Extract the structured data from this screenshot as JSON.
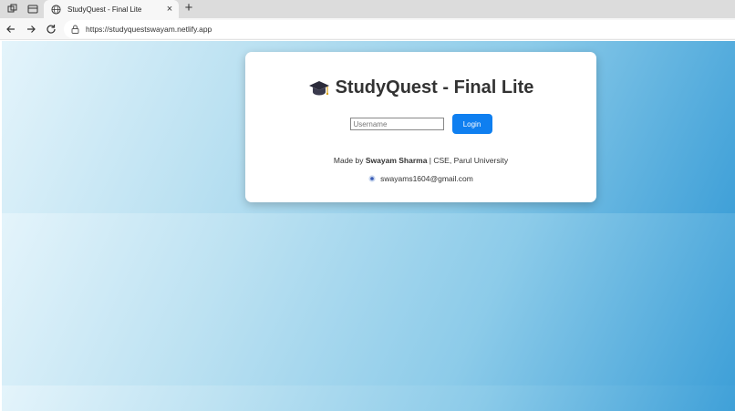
{
  "browser": {
    "tab_title": "StudyQuest - Final Lite",
    "tab_close": "×",
    "new_tab": "+",
    "url": "https://studyquestswayam.netlify.app"
  },
  "page": {
    "title": "StudyQuest - Final Lite",
    "username_placeholder": "Username",
    "login_label": "Login",
    "credit_prefix": "Made by ",
    "credit_name": "Swayam Sharma",
    "credit_suffix": " | CSE, Parul University",
    "email": "swayams1604@gmail.com"
  },
  "colors": {
    "login_button": "#0f7ff0",
    "gradient_start": "#e4f4fb",
    "gradient_end": "#3fa0d8",
    "title_text": "#333333"
  }
}
